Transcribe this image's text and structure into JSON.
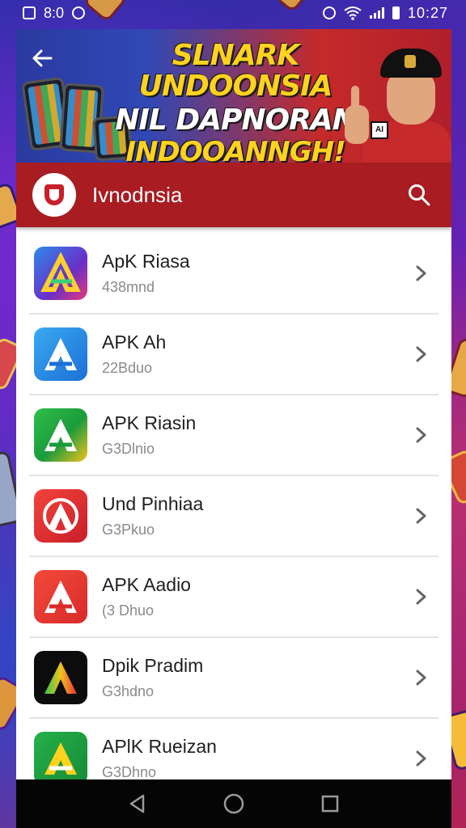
{
  "status_bar": {
    "left_text": "8:0",
    "time": "10:27",
    "icons": [
      "notification-icon",
      "screen-icon",
      "alarm-icon",
      "wifi-icon",
      "signal-icon",
      "battery-icon"
    ]
  },
  "banner": {
    "line1": "SLNARK UNDOONSIA",
    "line2": "NIL DAPNORAN",
    "line3": "INDOOANNGH!",
    "sign_text": "AI"
  },
  "header": {
    "title": "Ivnodnsia",
    "accent_color": "#a81c22"
  },
  "apps": [
    {
      "name": "ApK Riasa",
      "size": "438mnd",
      "icon": "apk-icon-purple"
    },
    {
      "name": "APK Ah",
      "size": "22Bduo",
      "icon": "apk-icon-blue"
    },
    {
      "name": "APK Riasin",
      "size": "G3Dlnio",
      "icon": "apk-icon-green"
    },
    {
      "name": "Und Pinhiaa",
      "size": "G3Pkuo",
      "icon": "apk-icon-red"
    },
    {
      "name": "APK Aadio",
      "size": "(3 Dhuo",
      "icon": "apk-icon-red2"
    },
    {
      "name": "Dpik Pradim",
      "size": "G3hdno",
      "icon": "apk-icon-black"
    },
    {
      "name": "APlK Rueizan",
      "size": "G3Dhno",
      "icon": "apk-icon-green2"
    }
  ],
  "nav": {
    "back": "back-icon",
    "home": "home-icon",
    "recents": "recents-icon"
  }
}
